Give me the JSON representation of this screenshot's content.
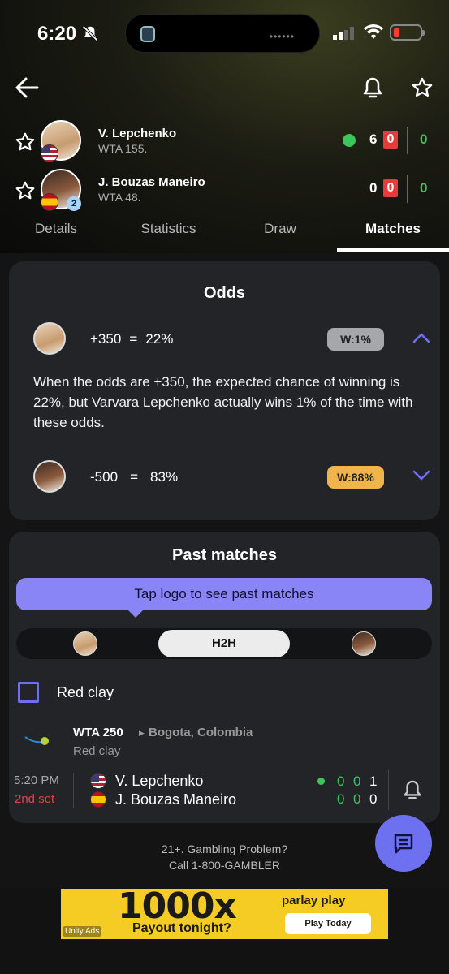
{
  "status_bar": {
    "time": "6:20",
    "island_dots": "••••••"
  },
  "players": [
    {
      "name": "V. Lepchenko",
      "rank": "WTA 155.",
      "sets": "6",
      "games": "0",
      "points": "0",
      "serving": true
    },
    {
      "name": "J. Bouzas Maneiro",
      "rank": "WTA 48.",
      "seed": "2",
      "sets": "0",
      "games": "0",
      "points": "0",
      "serving": false
    }
  ],
  "tabs": [
    "Details",
    "Statistics",
    "Draw",
    "Matches"
  ],
  "active_tab": "Matches",
  "odds": {
    "title": "Odds",
    "rows": [
      {
        "line": "+350",
        "eq": "=",
        "pct": "22%",
        "badge": "W:1%"
      },
      {
        "line": "-500",
        "eq": "=",
        "pct": "83%",
        "badge": "W:88%"
      }
    ],
    "description": "When the odds are +350, the expected chance of winning is 22%, but Varvara Lepchenko actually wins 1% of the time with these odds."
  },
  "past_matches": {
    "title": "Past matches",
    "tooltip": "Tap logo to see past matches",
    "segment_center": "H2H",
    "filter_label": "Red clay",
    "tournament": {
      "name": "WTA 250",
      "location": "Bogota, Colombia",
      "surface": "Red clay"
    },
    "match": {
      "time": "5:20 PM",
      "status": "2nd set",
      "p1": {
        "name": "V. Lepchenko",
        "scores": [
          "0",
          "0",
          "1"
        ]
      },
      "p2": {
        "name": "J. Bouzas Maneiro",
        "scores": [
          "0",
          "0",
          "0"
        ]
      }
    }
  },
  "legal": {
    "line1": "21+. Gambling Problem?",
    "line2": "Call 1-800-GAMBLER"
  },
  "ad": {
    "headline": "1000x",
    "sub": "Payout tonight?",
    "brand": "parlay play",
    "cta": "Play Today",
    "network": "Unity Ads"
  },
  "colors": {
    "accent": "#6d71f0",
    "live_red": "#e53b3b",
    "serve_green": "#3cc55a",
    "gold_badge": "#f0b54a"
  }
}
